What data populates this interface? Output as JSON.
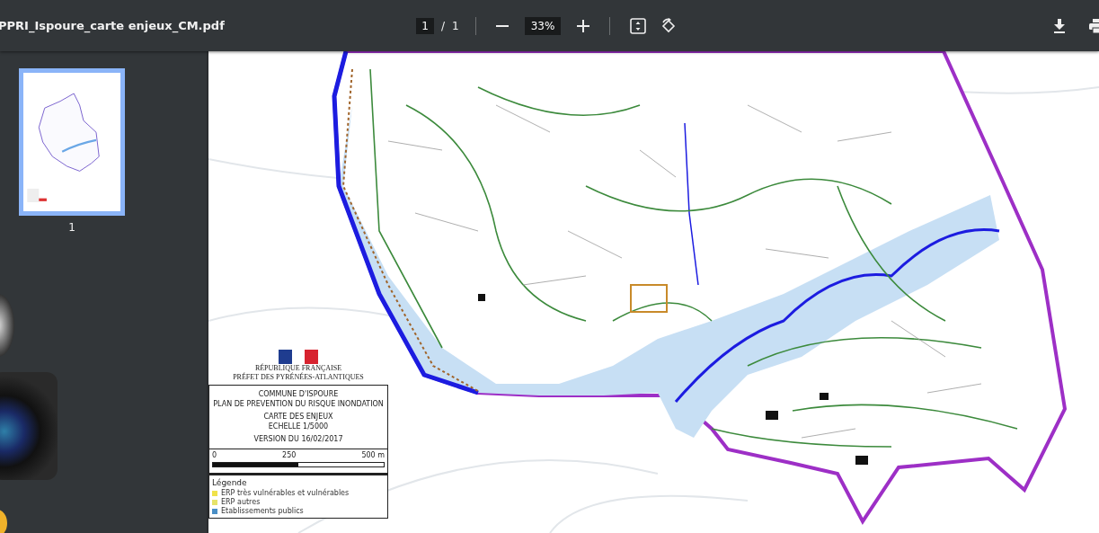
{
  "toolbar": {
    "title": "PPRI_Ispoure_carte enjeux_CM.pdf",
    "page_current": "1",
    "page_separator": "/",
    "page_total": "1",
    "zoom": "33%"
  },
  "thumbnails": [
    {
      "label": "1",
      "selected": true
    }
  ],
  "map": {
    "prefecture": [
      "RÉPUBLIQUE FRANÇAISE",
      "PRÉFET DES PYRÉNÉES-ATLANTIQUES"
    ],
    "title_lines": [
      "COMMUNE D'ISPOURE",
      "PLAN DE PREVENTION DU RISQUE INONDATION",
      "CARTE DES ENJEUX",
      "ECHELLE 1/5000",
      "VERSION DU 16/02/2017"
    ],
    "scale_labels": [
      "0",
      "250",
      "500 m"
    ],
    "legend_title": "Légende",
    "legend": [
      {
        "label": "ERP très vulnérables et vulnérables",
        "color": "#f0e24a"
      },
      {
        "label": "ERP autres",
        "color": "#e6e36a"
      },
      {
        "label": "Etablissements publics",
        "color": "#4a8fc6"
      }
    ]
  }
}
